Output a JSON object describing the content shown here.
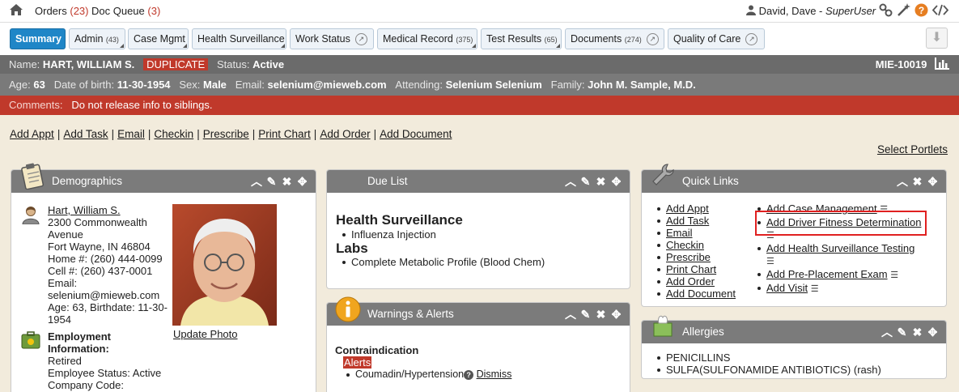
{
  "topbar": {
    "orders_label": "Orders",
    "orders_count": "(23)",
    "docqueue_label": "Doc Queue",
    "docqueue_count": "(3)",
    "user_name": "David, Dave",
    "user_role": "SuperUser"
  },
  "tabs": {
    "summary": "Summary",
    "admin": "Admin",
    "admin_count": "(43)",
    "case_mgmt": "Case Mgmt",
    "health_surv": "Health Surveillance",
    "work_status": "Work Status",
    "medical_record": "Medical Record",
    "medical_record_count": "(375)",
    "test_results": "Test Results",
    "test_results_count": "(65)",
    "documents": "Documents",
    "documents_count": "(274)",
    "quality_of_care": "Quality of Care"
  },
  "patient": {
    "name_label": "Name:",
    "name": "HART, WILLIAM S.",
    "duplicate": "DUPLICATE",
    "status_label": "Status:",
    "status": "Active",
    "mrn": "MIE-10019",
    "age_label": "Age:",
    "age": "63",
    "dob_label": "Date of birth:",
    "dob": "11-30-1954",
    "sex_label": "Sex:",
    "sex": "Male",
    "email_label": "Email:",
    "email": "selenium@mieweb.com",
    "attending_label": "Attending:",
    "attending": "Selenium Selenium",
    "family_label": "Family:",
    "family": "John M. Sample, M.D.",
    "comments_label": "Comments:",
    "comments": "Do not release info to siblings."
  },
  "actions": [
    "Add Appt",
    "Add Task",
    "Email",
    "Checkin",
    "Prescribe",
    "Print Chart",
    "Add Order",
    "Add Document"
  ],
  "select_portlets": "Select Portlets",
  "demographics": {
    "title": "Demographics",
    "name_link": "Hart, William S.",
    "addr1": "2300 Commonwealth",
    "addr2": "Avenue",
    "addr3": "Fort Wayne, IN 46804",
    "home": "Home #: (260) 444-0099",
    "cell": "Cell #: (260) 437-0001",
    "email_label": "Email:",
    "email": "selenium@mieweb.com",
    "age_bd1": "Age: 63, Birthdate: 11-30-",
    "age_bd2": "1954",
    "update_photo": "Update Photo",
    "emp_title1": "Employment",
    "emp_title2": "Information:",
    "emp_status1": "Retired",
    "emp_status2": "Employee Status: Active",
    "company_code": "Company Code:"
  },
  "duelist": {
    "title": "Due List",
    "sec1": "Health Surveillance",
    "sec1_items": [
      "Influenza Injection"
    ],
    "sec2": "Labs",
    "sec2_items": [
      "Complete Metabolic Profile (Blood Chem)"
    ]
  },
  "warnings": {
    "title": "Warnings & Alerts",
    "heading": "Contraindication",
    "alerts_badge": "Alerts",
    "item": "Coumadin/Hypertension",
    "dismiss": "Dismiss"
  },
  "quicklinks": {
    "title": "Quick Links",
    "left": [
      "Add Appt",
      "Add Task",
      "Email",
      "Checkin",
      "Prescribe",
      "Print Chart",
      "Add Order",
      "Add Document"
    ],
    "right": [
      "Add Case Management",
      "Add Driver Fitness Determination",
      "Add Health Surveillance Testing",
      "Add Pre-Placement Exam",
      "Add Visit"
    ]
  },
  "allergies": {
    "title": "Allergies",
    "items": [
      "PENICILLINS",
      "SULFA(SULFONAMIDE ANTIBIOTICS) (rash)"
    ]
  },
  "colors": {
    "accent_blue": "#1f86c7",
    "header_gray": "#7b7b7b",
    "alert_red": "#c0392b",
    "page_bg": "#f2ebdc"
  }
}
